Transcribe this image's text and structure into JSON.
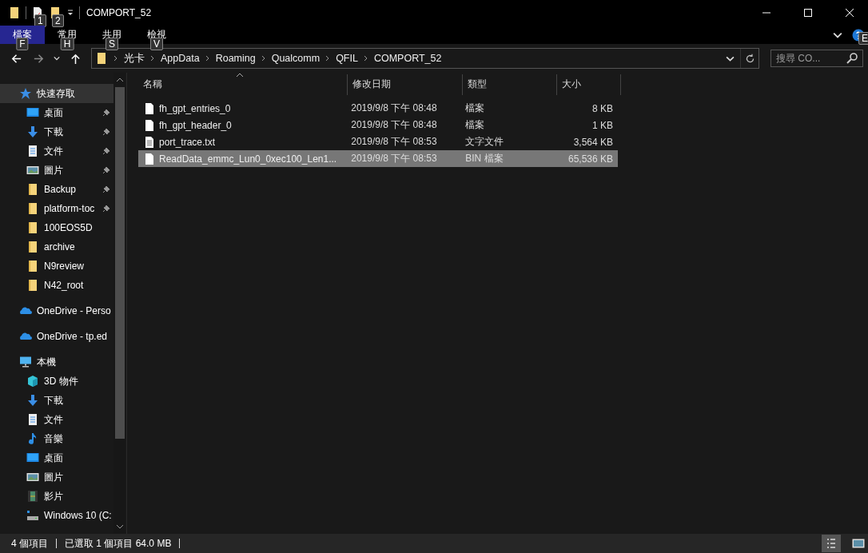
{
  "window": {
    "title": "COMPORT_52",
    "quick_access_keytips": [
      "1",
      "2"
    ]
  },
  "ribbon": {
    "tabs": [
      {
        "label": "檔案",
        "keytip": "F",
        "selected": true
      },
      {
        "label": "常用",
        "keytip": "H",
        "selected": false
      },
      {
        "label": "共用",
        "keytip": "S",
        "selected": false
      },
      {
        "label": "檢視",
        "keytip": "V",
        "selected": false
      }
    ],
    "help_keytip": "E"
  },
  "address_bar": {
    "path": [
      "光卡",
      "AppData",
      "Roaming",
      "Qualcomm",
      "QFIL",
      "COMPORT_52"
    ]
  },
  "search": {
    "placeholder": "搜尋 CO..."
  },
  "sidebar": {
    "items": [
      {
        "label": "快速存取",
        "kind": "star",
        "selected": true,
        "children": [
          {
            "label": "桌面",
            "kind": "desktop",
            "pinned": true
          },
          {
            "label": "下載",
            "kind": "download",
            "pinned": true
          },
          {
            "label": "文件",
            "kind": "document",
            "pinned": true
          },
          {
            "label": "圖片",
            "kind": "pictures",
            "pinned": true
          },
          {
            "label": "Backup",
            "kind": "folder",
            "pinned": true
          },
          {
            "label": "platform-toc",
            "kind": "folder",
            "pinned": true
          },
          {
            "label": "100EOS5D",
            "kind": "folder",
            "pinned": false
          },
          {
            "label": "archive",
            "kind": "folder",
            "pinned": false
          },
          {
            "label": "N9review",
            "kind": "folder",
            "pinned": false
          },
          {
            "label": "N42_root",
            "kind": "folder",
            "pinned": false
          }
        ]
      },
      {
        "label": "OneDrive - Perso",
        "kind": "cloud",
        "selected": false
      },
      {
        "label": "OneDrive - tp.ed",
        "kind": "cloud",
        "selected": false
      },
      {
        "label": "本機",
        "kind": "pc",
        "selected": false,
        "children": [
          {
            "label": "3D 物件",
            "kind": "cube",
            "pinned": false
          },
          {
            "label": "下載",
            "kind": "download",
            "pinned": false
          },
          {
            "label": "文件",
            "kind": "document",
            "pinned": false
          },
          {
            "label": "音樂",
            "kind": "music",
            "pinned": false
          },
          {
            "label": "桌面",
            "kind": "desktop",
            "pinned": false
          },
          {
            "label": "圖片",
            "kind": "pictures",
            "pinned": false
          },
          {
            "label": "影片",
            "kind": "video",
            "pinned": false
          },
          {
            "label": "Windows 10 (C:",
            "kind": "drive",
            "pinned": false
          }
        ]
      }
    ]
  },
  "table": {
    "columns": [
      "名稱",
      "修改日期",
      "類型",
      "大小"
    ],
    "rows": [
      {
        "name": "fh_gpt_entries_0",
        "kind": "file",
        "modified": "2019/9/8 下午 08:48",
        "type": "檔案",
        "size": "8 KB",
        "selected": false
      },
      {
        "name": "fh_gpt_header_0",
        "kind": "file",
        "modified": "2019/9/8 下午 08:48",
        "type": "檔案",
        "size": "1 KB",
        "selected": false
      },
      {
        "name": "port_trace.txt",
        "kind": "text",
        "modified": "2019/9/8 下午 08:53",
        "type": "文字文件",
        "size": "3,564 KB",
        "selected": false
      },
      {
        "name": "ReadData_emmc_Lun0_0xec100_Len1...",
        "kind": "file",
        "modified": "2019/9/8 下午 08:53",
        "type": "BIN 檔案",
        "size": "65,536 KB",
        "selected": true
      }
    ]
  },
  "status_bar": {
    "items": [
      "4 個項目",
      "已選取 1 個項目  64.0 MB"
    ],
    "view_buttons": [
      {
        "kind": "details",
        "selected": true
      },
      {
        "kind": "icons",
        "selected": false
      }
    ]
  }
}
